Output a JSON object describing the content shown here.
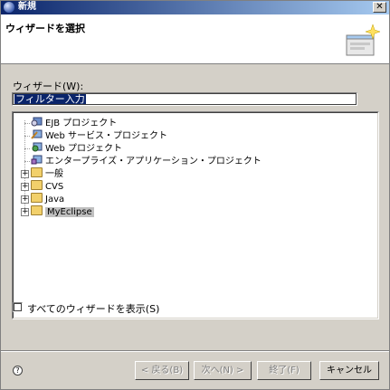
{
  "window": {
    "title": "新規",
    "close_glyph": "✕"
  },
  "header": {
    "title": "ウィザードを選択"
  },
  "wizard_label": "ウィザード(W):",
  "filter": {
    "value": "フィルター入力"
  },
  "tree": {
    "items": [
      {
        "label": "EJB プロジェクト",
        "icon": "ejb-project-icon",
        "expandable": false
      },
      {
        "label": "Web サービス・プロジェクト",
        "icon": "web-service-project-icon",
        "expandable": false
      },
      {
        "label": "Web プロジェクト",
        "icon": "web-project-icon",
        "expandable": false
      },
      {
        "label": "エンタープライズ・アプリケーション・プロジェクト",
        "icon": "enterprise-app-project-icon",
        "expandable": false
      },
      {
        "label": "一般",
        "icon": "folder-icon",
        "expandable": true
      },
      {
        "label": "CVS",
        "icon": "folder-icon",
        "expandable": true
      },
      {
        "label": "Java",
        "icon": "folder-icon",
        "expandable": true
      },
      {
        "label": "MyEclipse",
        "icon": "folder-icon",
        "expandable": true,
        "selected": true
      }
    ]
  },
  "show_all": {
    "label": "すべてのウィザードを表示(S)",
    "checked": false
  },
  "buttons": {
    "back": "< 戻る(B)",
    "next": "次へ(N) >",
    "finish": "終了(F)",
    "cancel": "キャンセル"
  },
  "help_glyph": "?"
}
